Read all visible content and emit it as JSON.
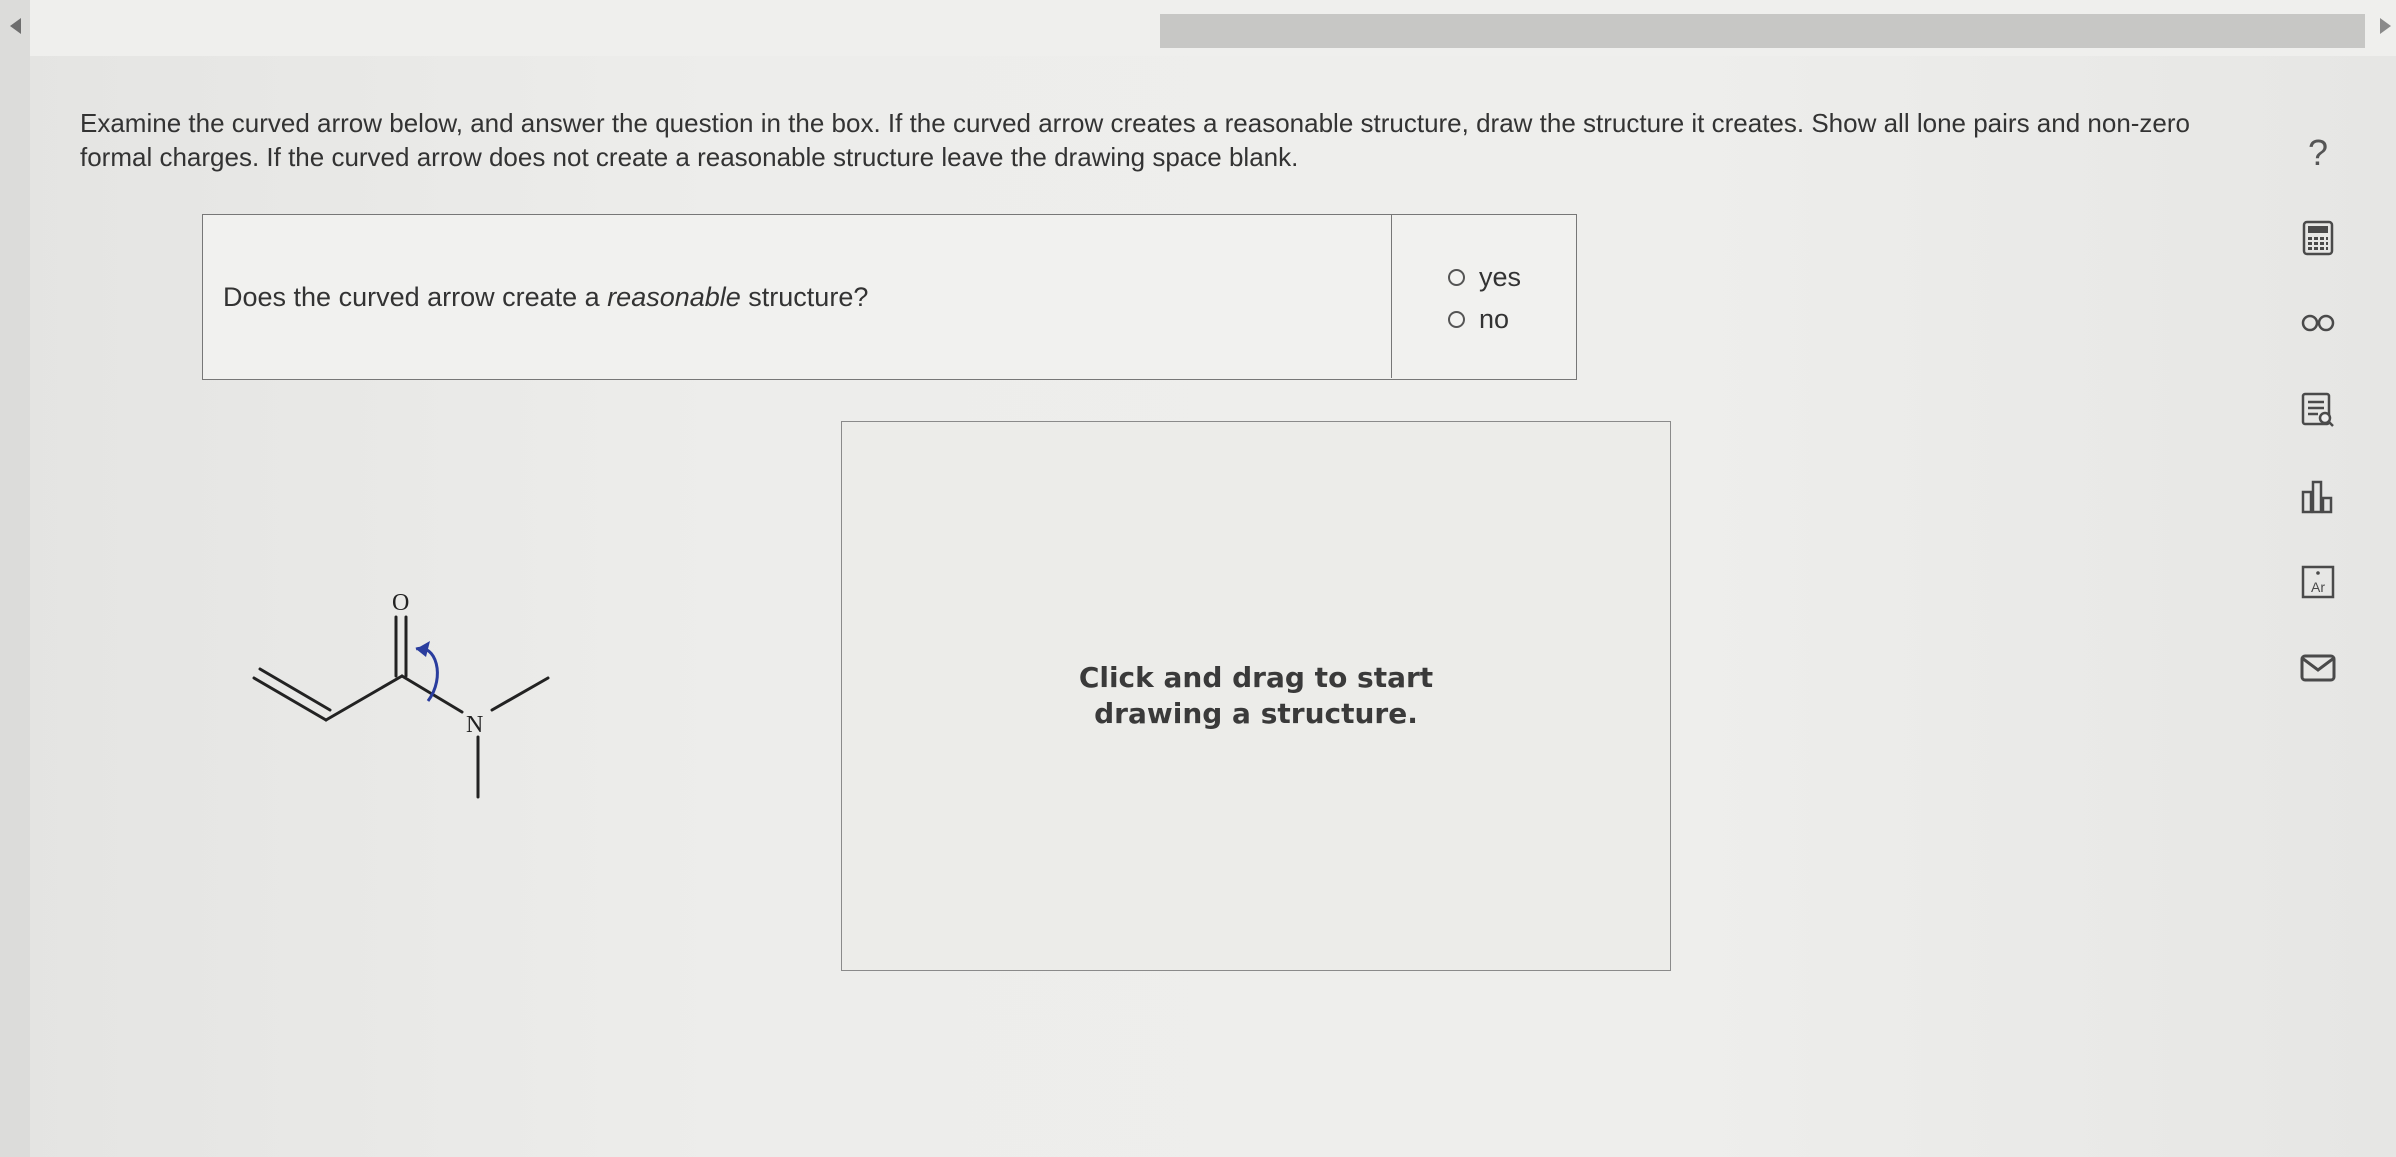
{
  "navigation": {
    "prev_icon": "chevron-left-icon",
    "next_icon": "chevron-right-icon",
    "progress_bar": "progress-track"
  },
  "instructions": "Examine the curved arrow below, and answer the question in the box. If the curved arrow creates a reasonable structure, draw the structure it creates. Show all lone pairs and non-zero formal charges. If the curved arrow does not create a reasonable structure leave the drawing space blank.",
  "question": {
    "prefix": "Does the curved arrow create a ",
    "emphasis": "reasonable",
    "suffix": " structure?",
    "options": [
      "yes",
      "no"
    ]
  },
  "molecule": {
    "atom_labels": [
      "O",
      "N"
    ],
    "arrow_color": "#2a3d9e"
  },
  "canvas": {
    "hint": "Click and drag to start\ndrawing a structure."
  },
  "sidebar_tools": {
    "help_label": "?",
    "periodic_label": "Ar",
    "icons": [
      "question-icon",
      "calculator-icon",
      "glasses-icon",
      "data-icon",
      "chart-icon",
      "periodic-table-icon",
      "mail-icon"
    ]
  }
}
